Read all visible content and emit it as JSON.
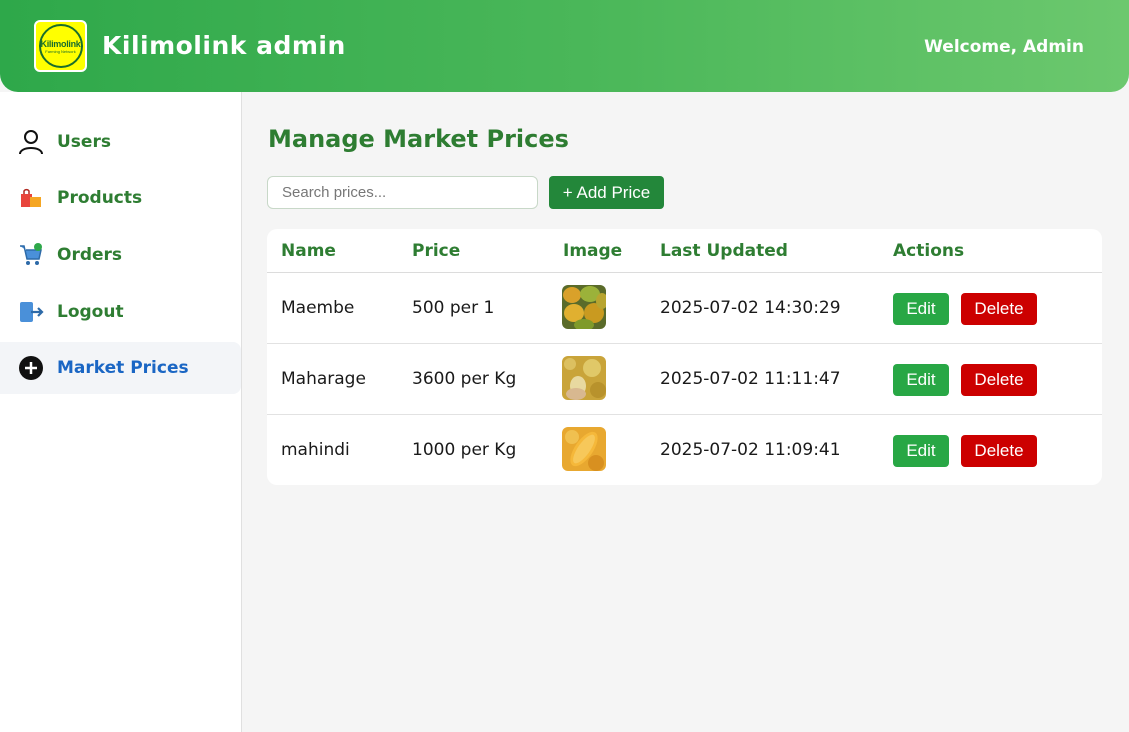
{
  "header": {
    "logo_text": "Kilimolink",
    "logo_subtext": "Farming Network",
    "title": "Kilimolink admin",
    "welcome": "Welcome, Admin"
  },
  "sidebar": {
    "items": [
      {
        "label": "Users",
        "icon": "user-icon"
      },
      {
        "label": "Products",
        "icon": "shopping-bags-icon"
      },
      {
        "label": "Orders",
        "icon": "cart-icon"
      },
      {
        "label": "Logout",
        "icon": "logout-icon"
      },
      {
        "label": "Market Prices",
        "icon": "plus-circle-icon",
        "active": true
      }
    ]
  },
  "main": {
    "title": "Manage Market Prices",
    "search": {
      "placeholder": "Search prices...",
      "value": ""
    },
    "add_button": "+ Add Price",
    "table": {
      "headers": [
        "Name",
        "Price",
        "Image",
        "Last Updated",
        "Actions"
      ],
      "rows": [
        {
          "name": "Maembe",
          "price": "500 per 1",
          "image": "mangoes",
          "updated": "2025-07-02 14:30:29",
          "edit": "Edit",
          "delete": "Delete"
        },
        {
          "name": "Maharage",
          "price": "3600 per Kg",
          "image": "grain",
          "updated": "2025-07-02 11:11:47",
          "edit": "Edit",
          "delete": "Delete"
        },
        {
          "name": "mahindi",
          "price": "1000 per Kg",
          "image": "maize",
          "updated": "2025-07-02 11:09:41",
          "edit": "Edit",
          "delete": "Delete"
        }
      ]
    }
  },
  "colors": {
    "header_start": "#2ea84a",
    "header_end": "#6cc86e",
    "brand_green": "#2e7d32",
    "active_blue": "#1a66c4",
    "edit": "#28a745",
    "delete": "#cc0000"
  }
}
